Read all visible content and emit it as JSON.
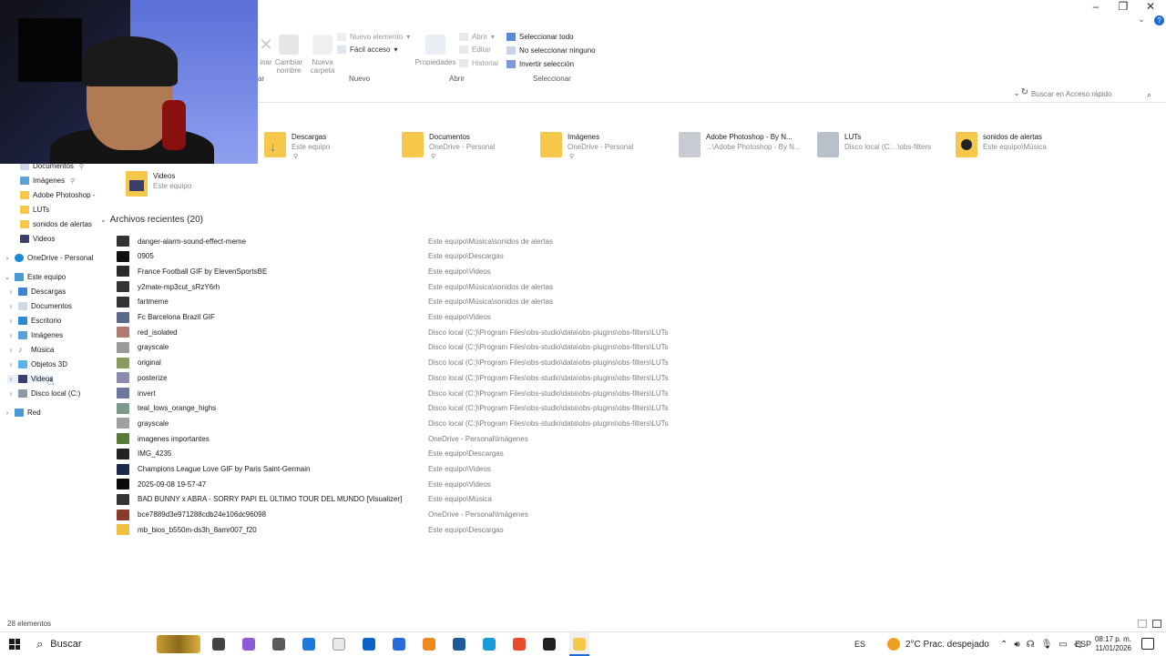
{
  "ribbon": {
    "partial_left_labels": [
      "inar",
      "Cambiar nombre",
      "Nueva carpeta"
    ],
    "new_item": "Nuevo elemento",
    "easy_access": "Fácil acceso",
    "properties": "Propiedades",
    "open": "Abrir",
    "edit": "Editar",
    "history": "Historial",
    "select_all": "Seleccionar todo",
    "select_none": "No seleccionar ninguno",
    "invert_selection": "Invertir selección",
    "group_new": "Nuevo",
    "group_open": "Abrir",
    "group_select": "Seleccionar",
    "group_partial": "ar"
  },
  "search": {
    "placeholder": "Buscar en Acceso rápido"
  },
  "quick_access": [
    {
      "name": "Descargas",
      "sub": "Este equipo",
      "color": "#3b82d6"
    },
    {
      "name": "Documentos",
      "sub": "OneDrive - Personal",
      "color": "#cfd8e6"
    },
    {
      "name": "Imágenes",
      "sub": "OneDrive - Personal",
      "color": "#5aa0d8"
    },
    {
      "name": "Adobe Photoshop - By N...",
      "sub": "...\\Adobe Photoshop - By N...",
      "color": "#9aa0a8"
    },
    {
      "name": "LUTs",
      "sub": "Disco local (C:...\\obs-filters",
      "color": "#8a95a8"
    },
    {
      "name": "sonidos de alertas",
      "sub": "Este equipo\\Música",
      "color": "#2a2a2a"
    },
    {
      "name": "Videos",
      "sub": "Este equipo",
      "color": "#6b6fb0"
    }
  ],
  "nav": {
    "quick": [
      {
        "label": "Documentos",
        "pinned": true
      },
      {
        "label": "Imágenes",
        "pinned": true
      },
      {
        "label": "Adobe Photoshop -",
        "pinned": false
      },
      {
        "label": "LUTs",
        "pinned": false
      },
      {
        "label": "sonidos de alertas",
        "pinned": false
      },
      {
        "label": "Videos",
        "pinned": false
      }
    ],
    "onedrive": "OneDrive - Personal",
    "this_pc": "Este equipo",
    "pc_items": [
      "Descargas",
      "Documentos",
      "Escritorio",
      "Imágenes",
      "Música",
      "Objetos 3D",
      "Videos",
      "Disco local (C:)"
    ],
    "network": "Red"
  },
  "recent": {
    "title": "Archivos recientes (20)",
    "rows": [
      {
        "name": "danger-alarm-sound-effect-meme",
        "path": "Este equipo\\Música\\sonidos de alertas",
        "color": "#333333"
      },
      {
        "name": "0905",
        "path": "Este equipo\\Descargas",
        "color": "#111111"
      },
      {
        "name": "France Football GIF by ElevenSportsBE",
        "path": "Este equipo\\Videos",
        "color": "#2a2a2a"
      },
      {
        "name": "y2mate-mp3cut_sRzY6rh",
        "path": "Este equipo\\Música\\sonidos de alertas",
        "color": "#333333"
      },
      {
        "name": "fartmeme",
        "path": "Este equipo\\Música\\sonidos de alertas",
        "color": "#333333"
      },
      {
        "name": "Fc Barcelona Brazil GIF",
        "path": "Este equipo\\Videos",
        "color": "#5a6a8a"
      },
      {
        "name": "red_isolated",
        "path": "Disco local (C:)\\Program Files\\obs-studio\\data\\obs-plugins\\obs-filters\\LUTs",
        "color": "#b07a70"
      },
      {
        "name": "grayscale",
        "path": "Disco local (C:)\\Program Files\\obs-studio\\data\\obs-plugins\\obs-filters\\LUTs",
        "color": "#9a9a9a"
      },
      {
        "name": "original",
        "path": "Disco local (C:)\\Program Files\\obs-studio\\data\\obs-plugins\\obs-filters\\LUTs",
        "color": "#8a9a5a"
      },
      {
        "name": "posterize",
        "path": "Disco local (C:)\\Program Files\\obs-studio\\data\\obs-plugins\\obs-filters\\LUTs",
        "color": "#8a8ab0"
      },
      {
        "name": "invert",
        "path": "Disco local (C:)\\Program Files\\obs-studio\\data\\obs-plugins\\obs-filters\\LUTs",
        "color": "#6a7aa0"
      },
      {
        "name": "teal_lows_orange_highs",
        "path": "Disco local (C:)\\Program Files\\obs-studio\\data\\obs-plugins\\obs-filters\\LUTs",
        "color": "#7a9a8a"
      },
      {
        "name": "grayscale",
        "path": "Disco local (C:)\\Program Files\\obs-studio\\data\\obs-plugins\\obs-filters\\LUTs",
        "color": "#a0a0a0"
      },
      {
        "name": "imagenes importantes",
        "path": "OneDrive - Personal\\Imágenes",
        "color": "#5a7a3a"
      },
      {
        "name": "IMG_4235",
        "path": "Este equipo\\Descargas",
        "color": "#222222"
      },
      {
        "name": "Champions League Love GIF by Paris Saint-Germain",
        "path": "Este equipo\\Videos",
        "color": "#1a2a4a"
      },
      {
        "name": "2025-09-08 19-57-47",
        "path": "Este equipo\\Videos",
        "color": "#0a0a0a"
      },
      {
        "name": "BAD BUNNY x ABRA - SORRY PAPI  EL ÚLTIMO TOUR DEL MUNDO [Visualizer]",
        "path": "Este equipo\\Música",
        "color": "#333333"
      },
      {
        "name": "bce7889d3e971288cdb24e106dc96098",
        "path": "OneDrive - Personal\\Imágenes",
        "color": "#8a3a2a"
      },
      {
        "name": "mb_bios_b550m-ds3h_8amr007_f20",
        "path": "Este equipo\\Descargas",
        "color": "#f0c040"
      }
    ]
  },
  "status": {
    "count": "28 elementos"
  },
  "taskbar": {
    "search": "Buscar",
    "lang": "ES",
    "weather": "2°C  Prac. despejado",
    "input_lang": "ESP",
    "time": "08:17 p. m.",
    "date": "11/01/2026",
    "apps": [
      {
        "name": "task-view-icon",
        "color": "#444444"
      },
      {
        "name": "copilot-icon",
        "color": "#8a5ad8"
      },
      {
        "name": "app-icon",
        "color": "#5a5a5a"
      },
      {
        "name": "photoshop-icon",
        "color": "#1e7ad8"
      },
      {
        "name": "file-icon",
        "color": "#e8e8e8"
      },
      {
        "name": "outlook-icon",
        "color": "#0a64c8"
      },
      {
        "name": "calendar-icon",
        "color": "#2a6ad8"
      },
      {
        "name": "ableton-icon",
        "color": "#f08a20"
      },
      {
        "name": "steam-icon",
        "color": "#1a5a9a"
      },
      {
        "name": "edge-icon",
        "color": "#1a9ad8"
      },
      {
        "name": "brave-icon",
        "color": "#e84a2a"
      },
      {
        "name": "obs-icon",
        "color": "#222222"
      },
      {
        "name": "file-explorer-icon",
        "color": "#f5c84b"
      }
    ]
  }
}
